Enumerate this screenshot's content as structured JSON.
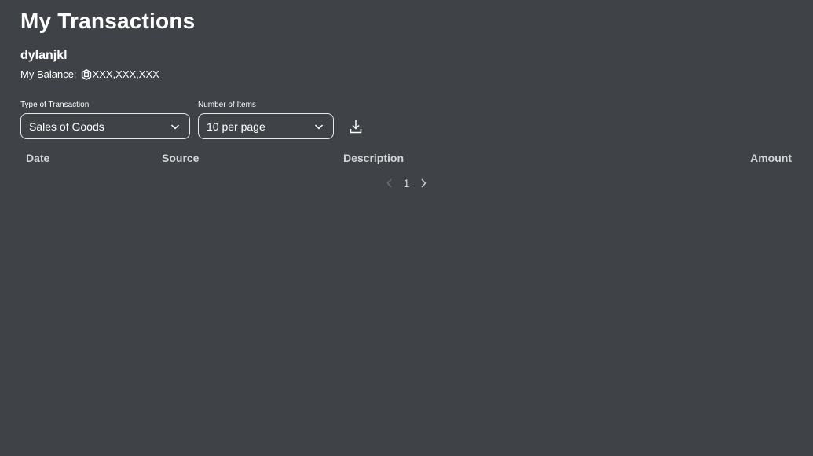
{
  "header": {
    "title": "My Transactions",
    "username": "dylanjkl",
    "balance_label": "My Balance:",
    "balance_value": "XXX,XXX,XXX"
  },
  "filters": {
    "type_label": "Type of Transaction",
    "type_value": "Sales of Goods",
    "items_label": "Number of Items",
    "items_value": "10 per page"
  },
  "table": {
    "columns": [
      "Date",
      "Source",
      "Description",
      "Amount"
    ],
    "rows": []
  },
  "pagination": {
    "current_page": "1"
  },
  "icons": {
    "currency": "robux-icon",
    "dropdown": "chevron-down-icon",
    "download": "download-icon",
    "prev": "chevron-left-icon",
    "next": "chevron-right-icon"
  },
  "colors": {
    "background": "#3f4246",
    "text": "#ffffff",
    "muted_text": "#d2d4d6",
    "border": "#e6e6e6"
  }
}
